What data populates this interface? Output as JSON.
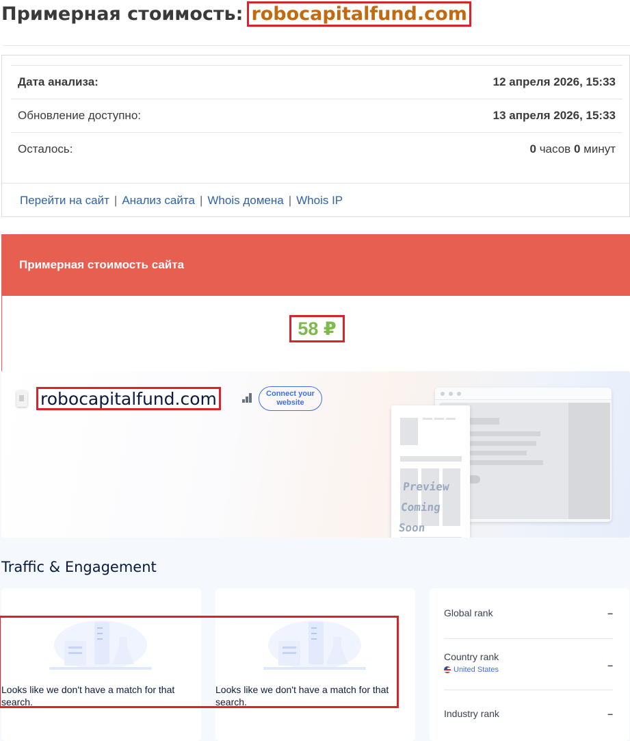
{
  "page": {
    "title_prefix": "Примерная стоимость:",
    "domain": "robocapitalfund.com"
  },
  "info": {
    "rows": [
      {
        "label": "Дата анализа:",
        "value": "12 апреля 2026, 15:33"
      },
      {
        "label": "Обновление доступно:",
        "value": "13 апреля 2026, 15:33"
      }
    ],
    "remaining": {
      "label": "Осталось:",
      "hours": "0",
      "hours_unit": "часов",
      "minutes": "0",
      "minutes_unit": "минут"
    },
    "links": [
      "Перейти на сайт",
      "Анализ сайта",
      "Whois домена",
      "Whois IP"
    ],
    "separator": "|"
  },
  "cost": {
    "header": "Примерная стоимость сайта",
    "value": "58 ₽"
  },
  "similarweb": {
    "domain": "robocapitalfund.com",
    "connect_button": "Connect your website",
    "preview_text": [
      "Preview",
      "Coming Soon"
    ],
    "section_title": "Traffic & Engagement",
    "empty_message": "Looks like we don't have a match for that search.",
    "ranks": [
      {
        "label": "Global rank",
        "value": "–"
      },
      {
        "label": "Country rank",
        "value": "–",
        "sub": "United States"
      },
      {
        "label": "Industry rank",
        "value": "–"
      }
    ]
  },
  "colors": {
    "header_red": "#e65f51",
    "value_green": "#7cbb4b",
    "domain_orange": "#c16a10",
    "highlight_red": "#d6242a",
    "link_blue": "#2f62a6"
  }
}
